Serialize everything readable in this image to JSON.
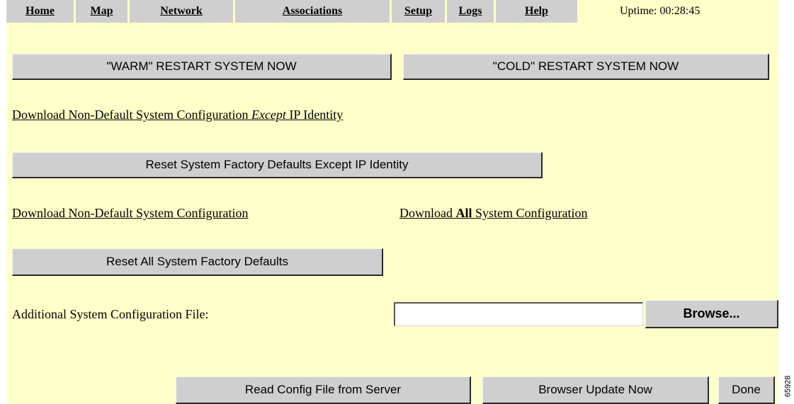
{
  "nav": {
    "items": [
      {
        "label": "Home"
      },
      {
        "label": "Map"
      },
      {
        "label": "Network"
      },
      {
        "label": "Associations"
      },
      {
        "label": "Setup"
      },
      {
        "label": "Logs"
      },
      {
        "label": "Help"
      }
    ],
    "uptime": "Uptime: 00:28:45"
  },
  "restart": {
    "warm_label": "\"WARM\" RESTART SYSTEM NOW",
    "cold_label": "\"COLD\" RESTART SYSTEM NOW"
  },
  "links": {
    "download_except_prefix": "Download Non-Default System Configuration ",
    "download_except_emph": "Except",
    "download_except_suffix": " IP Identity",
    "download_nondefault": "Download Non-Default System Configuration",
    "download_all_prefix": "Download ",
    "download_all_emph": "All",
    "download_all_suffix": " System Configuration"
  },
  "buttons": {
    "reset_except_ip": "Reset System Factory Defaults Except IP Identity",
    "reset_all": "Reset All System Factory Defaults",
    "browse": "Browse...",
    "read_config": "Read Config File from Server",
    "browser_update": "Browser Update Now",
    "done": "Done"
  },
  "config_file": {
    "label": "Additional System Configuration File:",
    "value": ""
  },
  "figure_id": "65928"
}
